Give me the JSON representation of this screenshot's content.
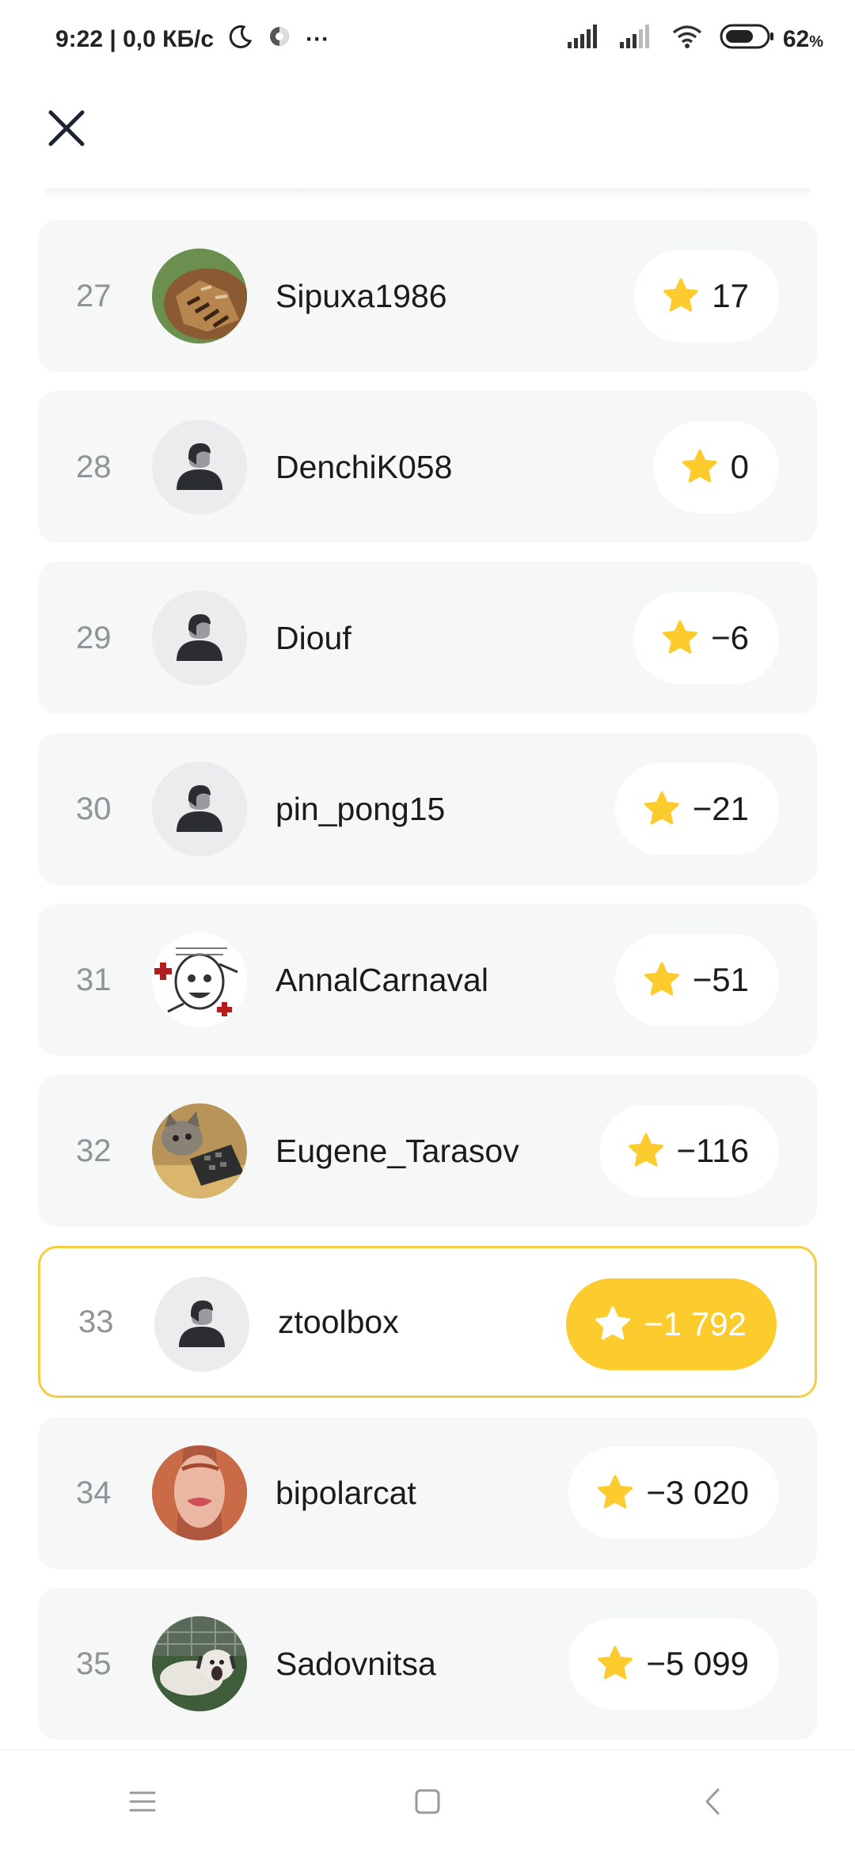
{
  "status_bar": {
    "time_speed": "9:22 | 0,0 КБ/с",
    "more": "···",
    "battery": "62",
    "battery_unit": "%"
  },
  "leaderboard": [
    {
      "rank": "27",
      "name": "Sipuxa1986",
      "score": "17",
      "avatar": "owl-photo",
      "current": false
    },
    {
      "rank": "28",
      "name": "DenchiK058",
      "score": "0",
      "avatar": "default",
      "current": false
    },
    {
      "rank": "29",
      "name": "Diouf",
      "score": "−6",
      "avatar": "default",
      "current": false
    },
    {
      "rank": "30",
      "name": "pin_pong15",
      "score": "−21",
      "avatar": "default",
      "current": false
    },
    {
      "rank": "31",
      "name": "AnnalCarnaval",
      "score": "−51",
      "avatar": "meme-drawing",
      "current": false
    },
    {
      "rank": "32",
      "name": "Eugene_Tarasov",
      "score": "−116",
      "avatar": "cat-photo",
      "current": false
    },
    {
      "rank": "33",
      "name": "ztoolbox",
      "score": "−1 792",
      "avatar": "default",
      "current": true
    },
    {
      "rank": "34",
      "name": "bipolarcat",
      "score": "−3 020",
      "avatar": "person-photo",
      "current": false
    },
    {
      "rank": "35",
      "name": "Sadovnitsa",
      "score": "−5 099",
      "avatar": "dog-photo",
      "current": false
    }
  ],
  "colors": {
    "accent": "#fccc2e",
    "row_bg": "#f6f7f7",
    "current_border": "#f1cf45",
    "rank_text": "#8f9498"
  },
  "icons": {
    "close": "close-icon",
    "star": "star-icon",
    "nav": [
      "menu-icon",
      "home-icon",
      "back-icon"
    ]
  }
}
